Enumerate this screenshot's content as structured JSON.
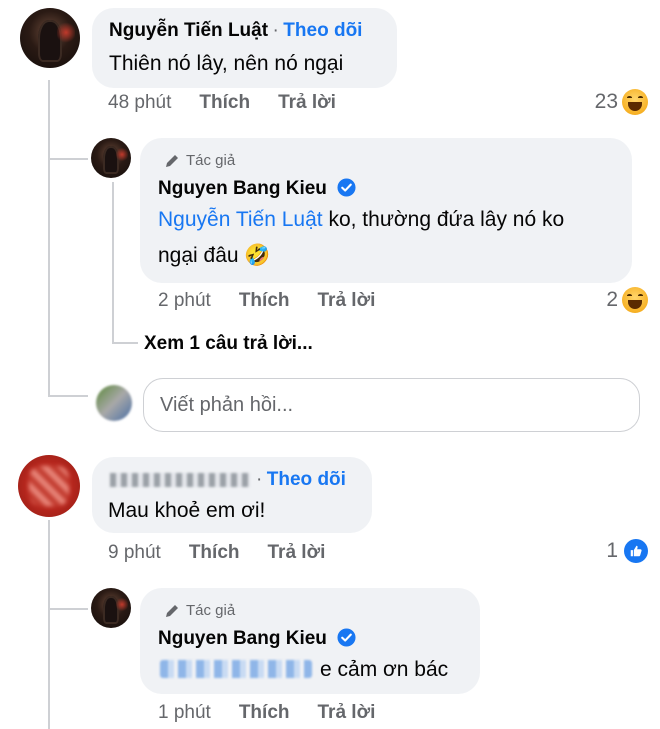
{
  "comment1": {
    "author": "Nguyễn Tiến Luật",
    "separator": "·",
    "follow": "Theo dõi",
    "text": "Thiên nó lây, nên nó ngại",
    "time": "48 phút",
    "like": "Thích",
    "reply": "Trả lời",
    "reaction_count": "23"
  },
  "reply1": {
    "tag": "Tác giả",
    "author": "Nguyen Bang Kieu",
    "mention": "Nguyễn Tiến Luật",
    "text_line1": " ko,  thường đứa lây nó ko",
    "text_line2": "ngại đâu ",
    "emoji": "🤣",
    "time": "2 phút",
    "like": "Thích",
    "reply": "Trả lời",
    "reaction_count": "2"
  },
  "see_more": "Xem 1 câu trả lời...",
  "reply_box": {
    "placeholder": "Viết phản hồi..."
  },
  "comment2": {
    "separator": "·",
    "follow": "Theo dõi",
    "text": "Mau khoẻ em ơi!",
    "time": "9 phút",
    "like": "Thích",
    "reply": "Trả lời",
    "reaction_count": "1"
  },
  "reply2": {
    "tag": "Tác giả",
    "author": "Nguyen Bang Kieu",
    "text": "e cảm ơn bác",
    "time": "1 phút",
    "like": "Thích",
    "reply": "Trả lời"
  },
  "colors": {
    "link": "#1877f2",
    "meta": "#65676b",
    "bubble": "#f0f2f5",
    "thread_line": "#ced0d4"
  },
  "icons": {
    "author_tag": "pencil-icon",
    "verified": "verified-badge-icon",
    "haha": "haha-reaction-icon",
    "like": "like-reaction-icon"
  }
}
